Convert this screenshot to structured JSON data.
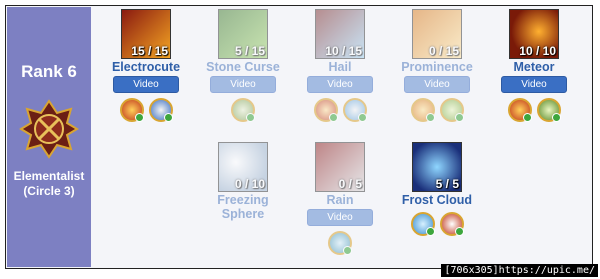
{
  "left": {
    "rank": "Rank 6",
    "class_name": "Elementalist",
    "circle": "(Circle 3)"
  },
  "skills": [
    {
      "name": "Electrocute",
      "count": "15 / 15",
      "video": "Video",
      "state": "active",
      "colors": [
        "#8a1a10",
        "#f5a623"
      ]
    },
    {
      "name": "Stone Curse",
      "count": "5 / 15",
      "video": "Video",
      "state": "dim",
      "colors": [
        "#3f7a2c",
        "#9dd46a"
      ]
    },
    {
      "name": "Hail",
      "count": "10 / 15",
      "video": "Video",
      "state": "dim",
      "colors": [
        "#7a2a2a",
        "#9fd3f2"
      ]
    },
    {
      "name": "Prominence",
      "count": "0 / 15",
      "video": "Video",
      "state": "dim",
      "colors": [
        "#d9791a",
        "#ffe29a"
      ]
    },
    {
      "name": "Meteor",
      "count": "10 / 10",
      "video": "Video",
      "state": "active",
      "colors": [
        "#7a1a08",
        "#ffb030"
      ]
    },
    {
      "name": "Freezing",
      "name2": "Sphere",
      "count": "0 / 10",
      "state": "dim",
      "colors": [
        "#9ab2cc",
        "#eef5ff"
      ]
    },
    {
      "name": "Rain",
      "count": "0 / 5",
      "video": "Video",
      "state": "dim",
      "colors": [
        "#8a1a1a",
        "#d8d8d8"
      ]
    },
    {
      "name": "Frost Cloud",
      "count": "5 / 5",
      "state": "active",
      "colors": [
        "#1a2f7a",
        "#8fd6ff"
      ]
    }
  ],
  "watermark": "[706x305]https://upic.me/"
}
